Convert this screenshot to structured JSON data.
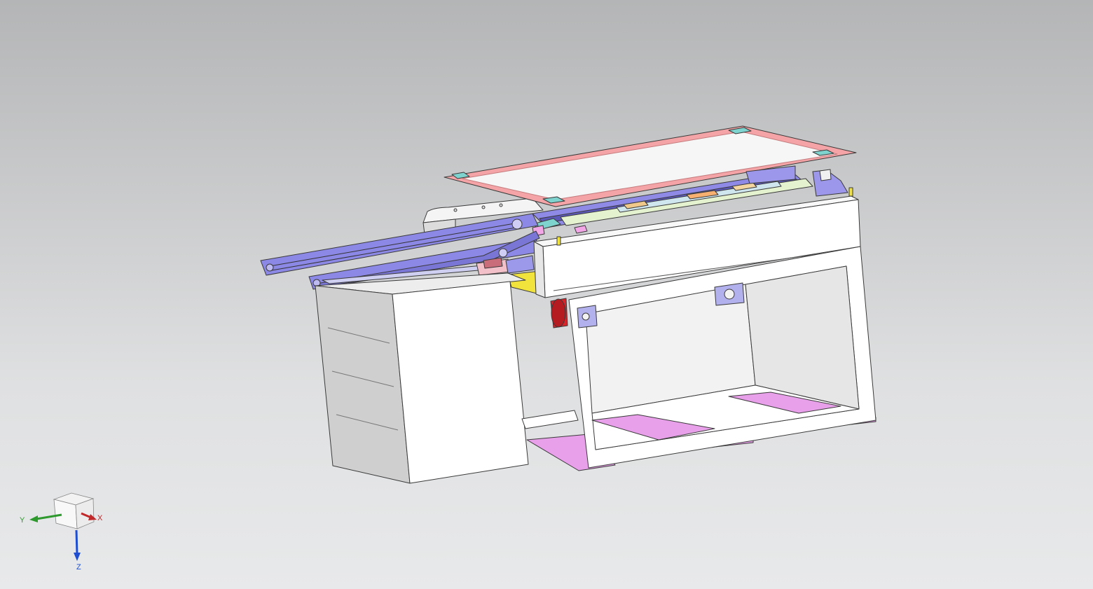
{
  "viewport": {
    "background_top": "#b4b5b6",
    "background_bottom": "#e8e9ea"
  },
  "triad": {
    "x_label": "X",
    "y_label": "Y",
    "z_label": "Z",
    "x_color": "#c0282a",
    "y_color": "#2e9a2e",
    "z_color": "#1f4fd0"
  },
  "model": {
    "description_colors": {
      "frame": "#ffffff",
      "conveyor": "#8a86e6",
      "cover_plate": "#f2a3a3",
      "base_pads": "#e9a0ea",
      "motor": "#d8242a",
      "bracket": "#f2e33c"
    }
  }
}
